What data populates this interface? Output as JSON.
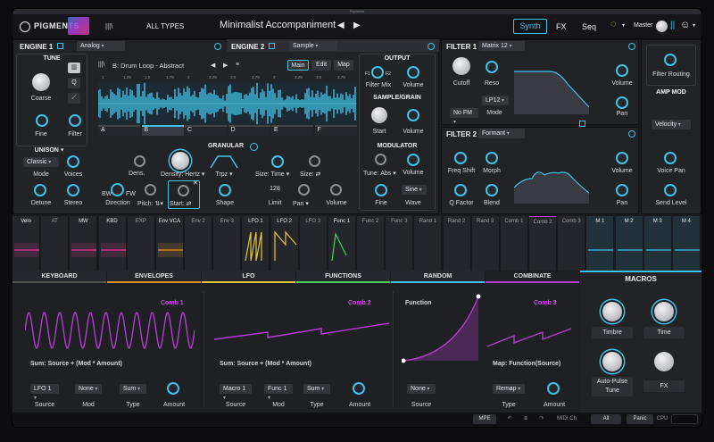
{
  "window_title": "Pigments",
  "topbar": {
    "logo": "PIGMENTS",
    "library_icon": "library-icon",
    "types": "ALL TYPES",
    "preset": "Minimalist Accompaniment",
    "tabs": [
      "Synth",
      "FX",
      "Seq"
    ],
    "master": "Master"
  },
  "engine1": {
    "title": "ENGINE 1",
    "type": "Analog",
    "tune_title": "TUNE",
    "coarse": "Coarse",
    "fine": "Fine",
    "filter": "Filter",
    "btn_q": "Q",
    "sample_path": "B: Drum Loop - Abstract",
    "tabs": [
      "Main",
      "Edit",
      "Map"
    ],
    "ruler": [
      "1",
      "1.25",
      "1.5",
      "1.75",
      "2",
      "2.25",
      "2.5",
      "2.75",
      "3",
      "3.25",
      "3.5",
      "3.75"
    ],
    "slots": [
      "A",
      "B",
      "C",
      "D",
      "E",
      "F"
    ],
    "unison_title": "UNISON",
    "mode_value": "Classic",
    "mode": "Mode",
    "voices": "Voices",
    "detune": "Detune",
    "stereo": "Stereo"
  },
  "engine2": {
    "title": "ENGINE 2",
    "type": "Sample"
  },
  "granular": {
    "title": "GRANULAR",
    "dens": "Dens.",
    "density": "Density: Hertz",
    "trpz": "Trpz",
    "size_time": "Size: Time",
    "size": "Size:",
    "direction": "Direction",
    "pitch": "Pitch:",
    "start": "Start:",
    "shape": "Shape",
    "limit_value": "128",
    "limit": "Limit",
    "pan": "Pan",
    "volume": "Volume",
    "bw": "BW",
    "fw": "FW"
  },
  "output": {
    "title": "OUTPUT",
    "f1": "F1",
    "f2": "F2",
    "filter_mix": "Filter Mix",
    "volume": "Volume",
    "sample_grain": "SAMPLE/GRAIN",
    "start": "Start",
    "volume2": "Volume",
    "modulator": "MODULATOR",
    "tune_abs": "Tune: Abs",
    "volume3": "Volume",
    "sine": "Sine",
    "fine": "Fine",
    "wave": "Wave"
  },
  "filter1": {
    "title": "FILTER 1",
    "type": "Matrix 12",
    "cutoff": "Cutoff",
    "reso": "Reso",
    "lp": "LP12",
    "nofm": "No FM",
    "mode": "Mode",
    "volume": "Volume",
    "pan": "Pan"
  },
  "filter2": {
    "title": "FILTER 2",
    "type": "Formant",
    "freq_shift": "Freq Shift",
    "morph": "Morph",
    "q_factor": "Q Factor",
    "blend": "Blend",
    "volume": "Volume",
    "pan": "Pan"
  },
  "right": {
    "filter_routing": "Filter Routing",
    "amp_mod": "AMP MOD",
    "velocity": "Velocity",
    "voice_pan": "Voice Pan",
    "send_level": "Send Level"
  },
  "mod_sources": [
    "Velo",
    "AT",
    "MW",
    "KBD",
    "EXP",
    "Env VCA",
    "Env 2",
    "Env 3",
    "LFO 1",
    "LFO 2",
    "LFO 3",
    "Func 1",
    "Func 2",
    "Func 3",
    "Rand 1",
    "Rand 2",
    "Rand 3",
    "Comb 1",
    "Comb 2",
    "Comb 3",
    "M 1",
    "M 2",
    "M 3",
    "M 4"
  ],
  "bottom_tabs": [
    "KEYBOARD",
    "ENVELOPES",
    "LFO",
    "FUNCTIONS",
    "RANDOM",
    "COMBINATE"
  ],
  "comb1": {
    "title": "Comb 1",
    "formula": "Sum: Source + (Mod * Amount)",
    "source_value": "LFO 1",
    "mod_value": "None",
    "type_value": "Sum",
    "source": "Source",
    "mod": "Mod",
    "type": "Type",
    "amount": "Amount"
  },
  "comb2": {
    "title": "Comb 2",
    "formula": "Sum: Source + (Mod * Amount)",
    "source_value": "Macro 1",
    "mod_value": "Func 1",
    "type_value": "Sum",
    "source": "Source",
    "mod": "Mod",
    "type": "Type",
    "amount": "Amount"
  },
  "comb3": {
    "function_label": "Function",
    "title": "Comb 3",
    "formula": "Map: Function(Source)",
    "source_value": "None",
    "type_value": "Remap",
    "source": "Source",
    "type": "Type",
    "amount": "Amount"
  },
  "macros": {
    "title": "MACROS",
    "names": [
      "Timbre",
      "Time",
      "Auto-Pulse Tune",
      "FX"
    ]
  },
  "bottombar": {
    "mpe": "MPE",
    "midi_ch": "MIDI Ch",
    "all": "All",
    "panic": "Panic",
    "cpu": "CPU"
  },
  "colors": {
    "accent": "#3ec3e8",
    "purple": "#b53bd1",
    "yellow": "#e2c73a",
    "green": "#4bd15a",
    "magenta": "#e23a8f",
    "orange": "#e28f2a"
  }
}
